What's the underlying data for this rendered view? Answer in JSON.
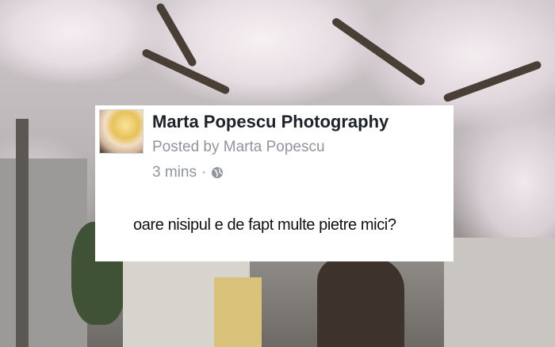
{
  "post": {
    "page_name": "Marta Popescu Photography",
    "posted_by": "Posted by Marta Popescu",
    "time": "3 mins",
    "separator": "·",
    "privacy_icon": "globe-icon",
    "text": "oare nisipul e de fapt multe pietre mici?"
  },
  "background": {
    "icon": "cherry-blossom-photo"
  }
}
